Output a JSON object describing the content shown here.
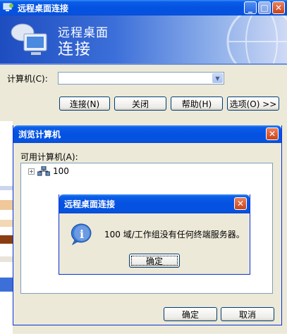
{
  "main_window": {
    "title": "远程桌面连接",
    "banner_line1": "远程桌面",
    "banner_line2": "连接",
    "computer_label": "计算机(C):",
    "computer_value": "",
    "buttons": {
      "connect": "连接(N)",
      "close": "关闭",
      "help": "帮助(H)",
      "options": "选项(O) >>"
    }
  },
  "browse_dialog": {
    "title": "浏览计算机",
    "available_label": "可用计算机(A):",
    "tree": [
      {
        "label": "100",
        "expander": "+"
      }
    ],
    "ok": "确定",
    "cancel": "取消"
  },
  "message_box": {
    "title": "远程桌面连接",
    "icon": "info-icon",
    "text": "100 域/工作组没有任何终端服务器。",
    "ok": "确定"
  },
  "colors": {
    "title_bar": "#0553e0",
    "dialog_face": "#ece9d8",
    "close_button": "#c8431b",
    "button_border": "#003c74"
  }
}
